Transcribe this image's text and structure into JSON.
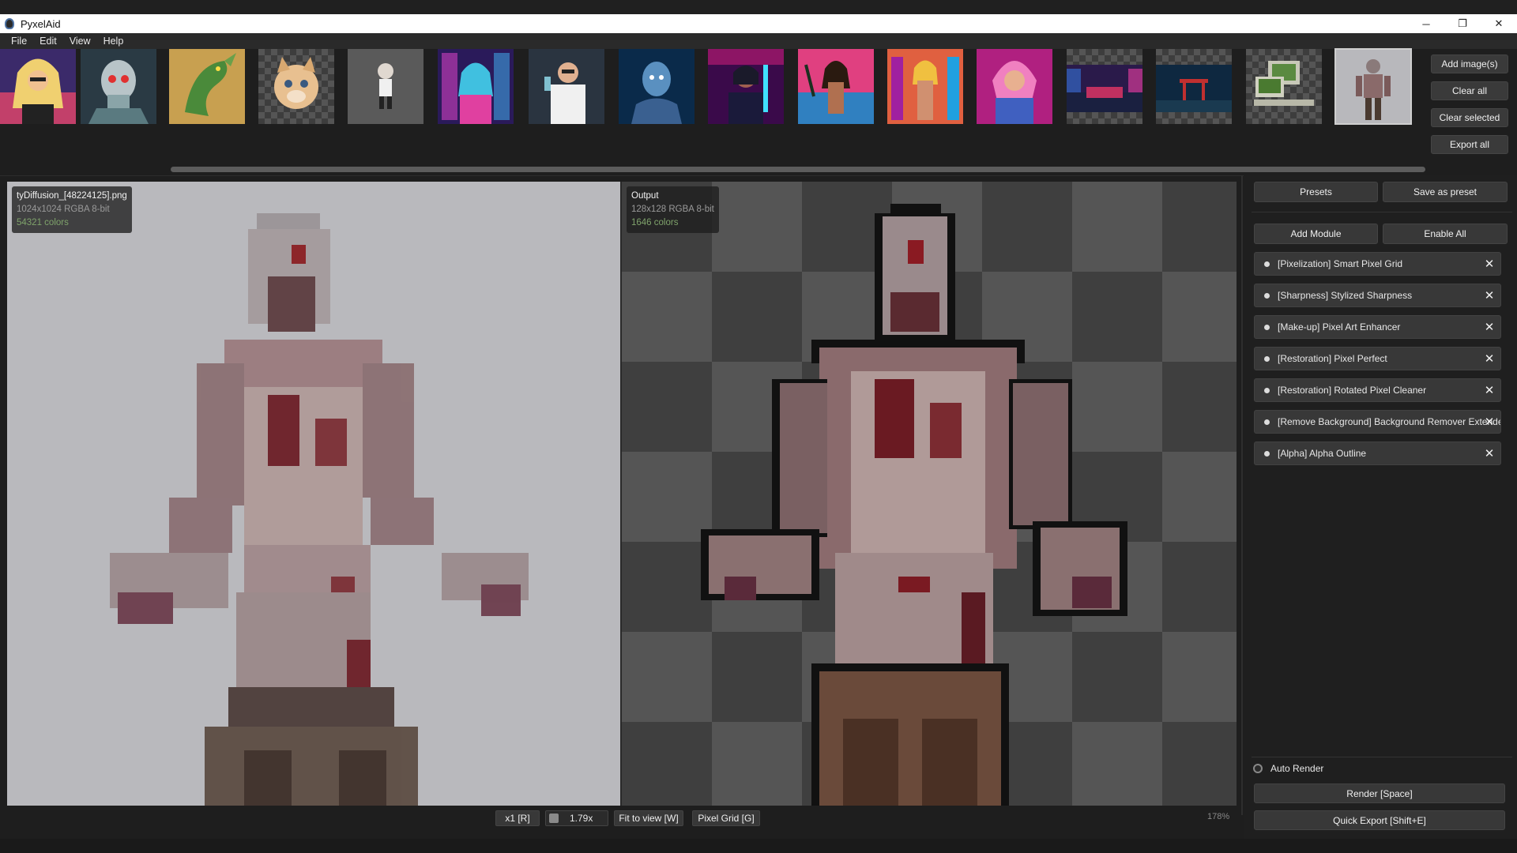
{
  "window": {
    "title": "PyxelAid",
    "min": "─",
    "restore": "❐",
    "close": "✕"
  },
  "menu": [
    "File",
    "Edit",
    "View",
    "Help"
  ],
  "thumbnail_actions": {
    "add": "Add image(s)",
    "clear_all": "Clear all",
    "clear_selected": "Clear selected",
    "export_all": "Export all"
  },
  "thumbnails": [
    "synthwave-blonde-woman",
    "cyborg-skull",
    "green-dragon",
    "kitten",
    "chibi-figure",
    "neon-cyberpunk-woman",
    "scientist",
    "blue-alien",
    "neon-jacket-woman",
    "beach-woman",
    "neon-city-woman",
    "pink-hair-woman",
    "neon-car-street",
    "torii-gate-night",
    "retro-computers",
    "zombie-figure"
  ],
  "input_info": {
    "filename": "tyDiffusion_[48224125].png",
    "meta": "1024x1024  RGBA  8-bit",
    "colors": "54321 colors"
  },
  "output_info": {
    "title": "Output",
    "meta": "128x128  RGBA  8-bit",
    "colors": "1646 colors"
  },
  "panel": {
    "presets": "Presets",
    "save_preset": "Save as preset",
    "add_module": "Add Module",
    "enable_all": "Enable All",
    "modules": [
      "[Pixelization] Smart Pixel Grid",
      "[Sharpness] Stylized Sharpness",
      "[Make-up] Pixel Art Enhancer",
      "[Restoration] Pixel Perfect",
      "[Restoration] Rotated Pixel Cleaner",
      "[Remove Background] Background Remover Extended",
      "[Alpha] Alpha Outline"
    ],
    "auto_render": "Auto Render",
    "render": "Render  [Space]",
    "quick_export": "Quick Export  [Shift+E]"
  },
  "viewer_controls": {
    "x1": "x1 [R]",
    "zoom": "1.79x",
    "fit": "Fit to view [W]",
    "grid": "Pixel Grid [G]",
    "zoom_percent": "178%"
  }
}
